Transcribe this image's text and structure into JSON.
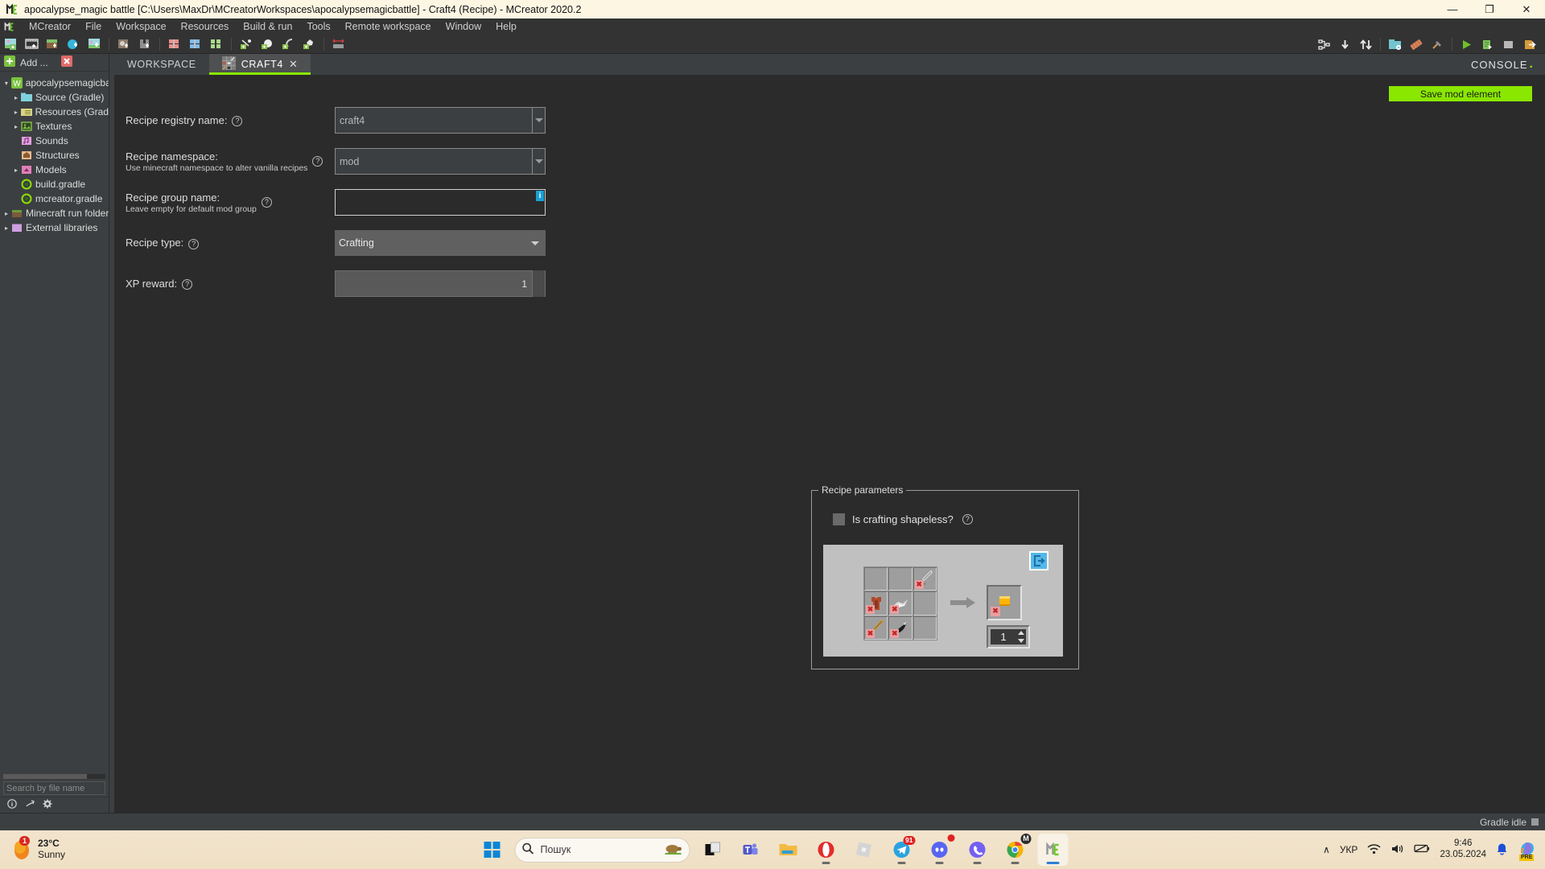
{
  "window": {
    "title": "apocalypse_magic battle [C:\\Users\\MaxDr\\MCreatorWorkspaces\\apocalypsemagicbattle] - Craft4 (Recipe) - MCreator 2020.2",
    "app_icon": "mcreator-icon",
    "minimize": "—",
    "maximize": "❐",
    "close": "✕"
  },
  "menubar": {
    "logo": "mcreator-icon",
    "items": [
      {
        "label": "MCreator",
        "mnemonic": "M"
      },
      {
        "label": "File",
        "mnemonic": "F"
      },
      {
        "label": "Workspace",
        "mnemonic": "k"
      },
      {
        "label": "Resources",
        "mnemonic": "R"
      },
      {
        "label": "Build & run",
        "mnemonic": "B"
      },
      {
        "label": "Tools",
        "mnemonic": "T"
      },
      {
        "label": "Remote workspace",
        "mnemonic": "R"
      },
      {
        "label": "Window",
        "mnemonic": "W"
      },
      {
        "label": "Help",
        "mnemonic": "H"
      }
    ]
  },
  "toolbar": {
    "left_icons": [
      "new-mod-element-icon",
      "new-animation-icon",
      "new-block-icon",
      "new-liquid-icon",
      "new-biome-icon",
      "new-structure-icon",
      "new-armor-icon",
      "new-recipe-red-icon",
      "new-recipe-blue-icon",
      "new-recipe-green-icon",
      "add-tool-icon",
      "add-item-icon",
      "add-pickaxe-icon",
      "add-leaves-icon",
      "resize-icon"
    ],
    "right_icons": [
      "workspace-tree-icon",
      "import-icon",
      "export-icon",
      "folder-settings-icon",
      "texture-icon",
      "hammer-icon",
      "run-client-icon",
      "build-icon",
      "stop-icon",
      "export-mod-icon"
    ]
  },
  "sidebar": {
    "add_label": "Add ...",
    "add_icon": "plus-green-icon",
    "remove_icon": "close-red-icon",
    "tree": [
      {
        "label": "apocalypsemagicba",
        "icon": "workspace-icon",
        "arrow": "▾",
        "indent": 0
      },
      {
        "label": "Source (Gradle)",
        "icon": "folder-cyan-icon",
        "arrow": "▸",
        "indent": 1
      },
      {
        "label": "Resources (Gradl",
        "icon": "folder-yellow-icon",
        "arrow": "▸",
        "indent": 1
      },
      {
        "label": "Textures",
        "icon": "textures-icon",
        "arrow": "▸",
        "indent": 1
      },
      {
        "label": "Sounds",
        "icon": "sounds-icon",
        "arrow": "",
        "indent": 1
      },
      {
        "label": "Structures",
        "icon": "structures-icon",
        "arrow": "",
        "indent": 1
      },
      {
        "label": "Models",
        "icon": "models-icon",
        "arrow": "▸",
        "indent": 1
      },
      {
        "label": "build.gradle",
        "icon": "gradle-icon",
        "arrow": "",
        "indent": 1
      },
      {
        "label": "mcreator.gradle",
        "icon": "gradle-icon",
        "arrow": "",
        "indent": 1
      },
      {
        "label": "Minecraft run folder",
        "icon": "minecraft-folder-icon",
        "arrow": "▸",
        "indent": 0
      },
      {
        "label": "External libraries",
        "icon": "libraries-icon",
        "arrow": "▸",
        "indent": 0
      }
    ],
    "search_placeholder": "Search by file name",
    "bottom_icons": [
      "info-icon",
      "import-workspace-icon",
      "gear-icon"
    ]
  },
  "tabs": {
    "workspace": "WORKSPACE",
    "craft4": "CRAFT4",
    "craft4_icon": "recipe-icon",
    "close_icon": "✕",
    "console_label": "CONSOLE"
  },
  "editor": {
    "save_button": "Save mod element",
    "fields": [
      {
        "label": "Recipe registry name:",
        "sublabel": "",
        "help": "?",
        "control": "combo",
        "value": "craft4"
      },
      {
        "label": "Recipe namespace:",
        "sublabel": "Use minecraft namespace to alter vanilla recipes",
        "help": "?",
        "control": "combo",
        "value": "mod"
      },
      {
        "label": "Recipe group name:",
        "sublabel": "Leave empty for default mod group",
        "help": "?",
        "control": "text",
        "value": "",
        "badge": "i"
      },
      {
        "label": "Recipe type:",
        "sublabel": "",
        "help": "?",
        "control": "select",
        "value": "Crafting"
      },
      {
        "label": "XP reward:",
        "sublabel": "",
        "help": "?",
        "control": "spinner",
        "value": "1"
      }
    ]
  },
  "recipe_parameters": {
    "legend": "Recipe parameters",
    "shapeless_label": "Is crafting shapeless?",
    "shapeless_help": "?",
    "shapeless_checked": false,
    "export_icon": "export-recipe-icon",
    "grid_cells": [
      {
        "item": "",
        "icon": "empty"
      },
      {
        "item": "",
        "icon": "empty"
      },
      {
        "item": "iron-sword",
        "icon": "sword-icon",
        "badge": "✖"
      },
      {
        "item": "leather-tunic",
        "icon": "leather-tunic-icon",
        "badge": "✖"
      },
      {
        "item": "white-cloud",
        "icon": "cloud-icon",
        "badge": "✖"
      },
      {
        "item": "",
        "icon": "empty"
      },
      {
        "item": "blaze-rod",
        "icon": "rod-icon",
        "badge": "✖"
      },
      {
        "item": "black-item",
        "icon": "black-item-icon",
        "badge": "✖"
      },
      {
        "item": "",
        "icon": "empty"
      }
    ],
    "arrow_icon": "right-arrow-icon",
    "result": {
      "item": "gold-block",
      "icon": "gold-item-icon",
      "badge": "✖"
    },
    "amount": "1"
  },
  "statusbar": {
    "gradle_status": "Gradle idle",
    "stop_icon": "stop-square-icon"
  },
  "taskbar": {
    "weather": {
      "temp": "23°C",
      "condition": "Sunny",
      "badge": "1",
      "icon": "sun-icon"
    },
    "start_icon": "windows-start-icon",
    "search_placeholder": "Пошук",
    "search_icon": "search-icon",
    "search_decor": "turtle-icon",
    "apps": [
      {
        "name": "task-view",
        "icon": "task-view-icon",
        "running": false,
        "badge": ""
      },
      {
        "name": "microsoft-teams",
        "icon": "teams-icon",
        "running": false,
        "badge": ""
      },
      {
        "name": "file-explorer",
        "icon": "folder-icon",
        "running": false,
        "badge": ""
      },
      {
        "name": "opera",
        "icon": "opera-icon",
        "running": true,
        "badge": ""
      },
      {
        "name": "roblox",
        "icon": "roblox-icon",
        "running": false,
        "badge": ""
      },
      {
        "name": "telegram",
        "icon": "telegram-icon",
        "running": true,
        "badge": "91"
      },
      {
        "name": "discord",
        "icon": "discord-icon",
        "running": true,
        "badge": ""
      },
      {
        "name": "viber",
        "icon": "viber-icon",
        "running": true,
        "badge": ""
      },
      {
        "name": "google-chrome",
        "icon": "chrome-icon",
        "running": true,
        "badge": "M"
      },
      {
        "name": "mcreator",
        "icon": "mcreator-icon",
        "running": true,
        "badge": "",
        "active": true
      }
    ],
    "tray": {
      "chevron": "∧",
      "language": "УКР",
      "wifi_icon": "wifi-icon",
      "volume_icon": "volume-icon",
      "battery_icon": "battery-icon",
      "time": "9:46",
      "date": "23.05.2024",
      "bell_icon": "notification-bell-icon",
      "copilot_icon": "copilot-icon",
      "copilot_badge": "PRE"
    }
  },
  "colors": {
    "accent_green": "#8ae700",
    "panel_dark": "#3c3f41",
    "editor_bg": "#2b2b2b",
    "info_blue": "#1a9fd4",
    "taskbar_bg": "#efe0c4"
  }
}
